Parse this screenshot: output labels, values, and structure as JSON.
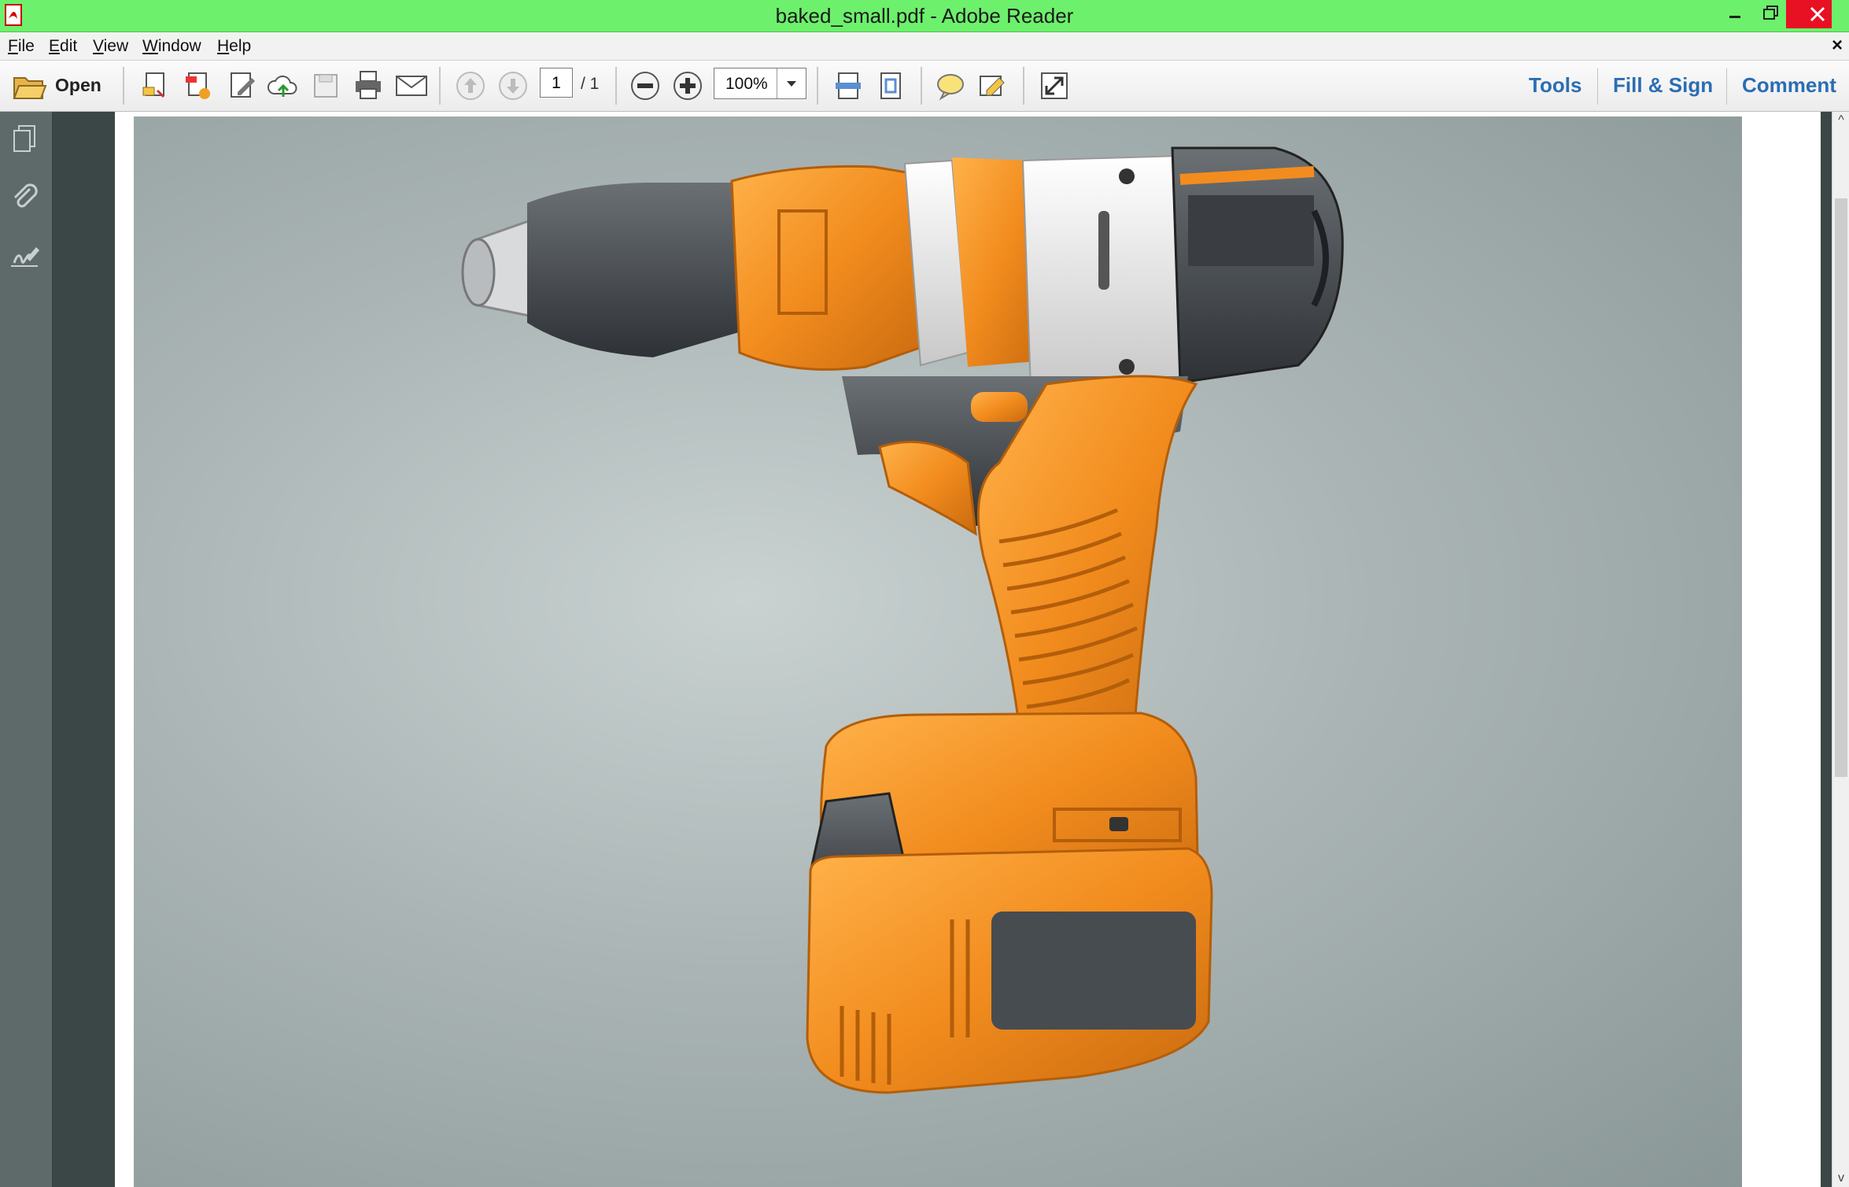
{
  "window": {
    "title": "baked_small.pdf - Adobe Reader"
  },
  "menu": {
    "items": [
      {
        "first": "F",
        "rest": "ile"
      },
      {
        "first": "E",
        "rest": "dit"
      },
      {
        "first": "V",
        "rest": "iew"
      },
      {
        "first": "W",
        "rest": "indow"
      },
      {
        "first": "H",
        "rest": "elp"
      }
    ],
    "close_glyph": "×"
  },
  "toolbar": {
    "open_label": "Open",
    "current_page": "1",
    "page_total": "/ 1",
    "zoom": "100%",
    "tools_label": "Tools",
    "fill_sign_label": "Fill & Sign",
    "comment_label": "Comment"
  },
  "scrollbar": {
    "up_glyph": "^",
    "down_glyph": "v"
  },
  "colors": {
    "titlebar": "#6df06c",
    "accent_link": "#2b6db3",
    "drill_orange": "#f28c1e",
    "drill_dark": "#4a4f54"
  },
  "icons": [
    "pdf-icon",
    "folder-open-icon",
    "create-pdf-icon",
    "combine-icon",
    "edit-icon",
    "upload-cloud-icon",
    "save-icon",
    "print-icon",
    "email-icon",
    "page-up-icon",
    "page-down-icon",
    "zoom-out-icon",
    "zoom-in-icon",
    "fit-width-icon",
    "fit-page-icon",
    "sticky-note-icon",
    "highlight-icon",
    "fullscreen-icon",
    "pages-icon",
    "attachments-icon",
    "signatures-icon"
  ]
}
